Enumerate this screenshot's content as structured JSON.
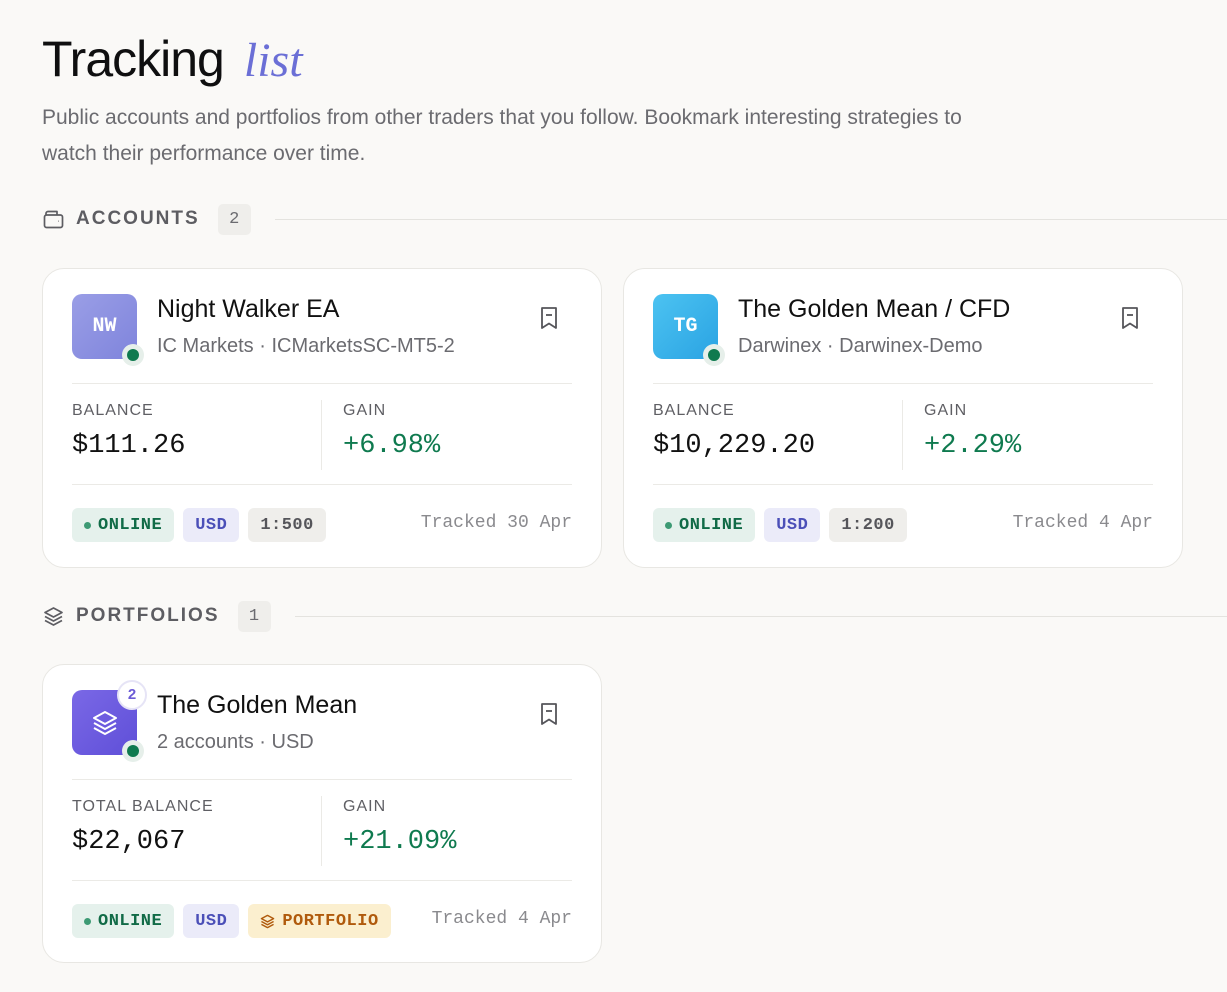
{
  "header": {
    "title": "Tracking",
    "title_accent": "list",
    "subtitle": "Public accounts and portfolios from other traders that you follow. Bookmark interesting strategies to watch their performance over time."
  },
  "sections": {
    "accounts": {
      "label": "ACCOUNTS",
      "count": "2",
      "icon": "wallet-icon"
    },
    "portfolios": {
      "label": "PORTFOLIOS",
      "count": "1",
      "icon": "layers-icon"
    }
  },
  "accounts": [
    {
      "initials": "NW",
      "name": "Night Walker EA",
      "sub": "IC Markets · ICMarketsSC-MT5-2",
      "balance_label": "BALANCE",
      "balance": "$111.26",
      "gain_label": "GAIN",
      "gain": "+6.98%",
      "status": "ONLINE",
      "currency": "USD",
      "leverage": "1:500",
      "tracked": "Tracked 30 Apr",
      "avatar_color": "#8b8fdf"
    },
    {
      "initials": "TG",
      "name": "The Golden Mean / CFD",
      "sub": "Darwinex · Darwinex-Demo",
      "balance_label": "BALANCE",
      "balance": "$10,229.20",
      "gain_label": "GAIN",
      "gain": "+2.29%",
      "status": "ONLINE",
      "currency": "USD",
      "leverage": "1:200",
      "tracked": "Tracked 4 Apr",
      "avatar_color": "#3bb2ea"
    }
  ],
  "portfolios": [
    {
      "accounts_count": "2",
      "name": "The Golden Mean",
      "sub": "2 accounts · USD",
      "balance_label": "TOTAL BALANCE",
      "balance": "$22,067",
      "gain_label": "GAIN",
      "gain": "+21.09%",
      "status": "ONLINE",
      "currency": "USD",
      "type": "PORTFOLIO",
      "tracked": "Tracked 4 Apr",
      "avatar_color": "#6f5ee0"
    }
  ],
  "colors": {
    "accent": "#6b6fd6",
    "online": "#0f7a4f",
    "gain": "#0f7a4f"
  }
}
